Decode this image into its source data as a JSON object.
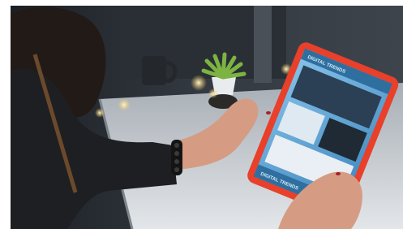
{
  "photo": {
    "subject": "woman-holding-tablet",
    "tablet": {
      "frame_color": "#e8402a",
      "screen_color": "#5fa6d6",
      "header_text": "DIGITAL TRENDS",
      "footer_text": "DIGITAL TRENDS"
    },
    "colors": {
      "background": "#2b3036",
      "table": "#c9ced3",
      "sweater": "#1e1f22",
      "skin": "#d59c83",
      "plant": "#7cb342",
      "bokeh": "#f2d58a"
    },
    "icons": [
      "bracelet-icon",
      "nail-polish-icon",
      "plant-icon",
      "mug-icon"
    ]
  }
}
